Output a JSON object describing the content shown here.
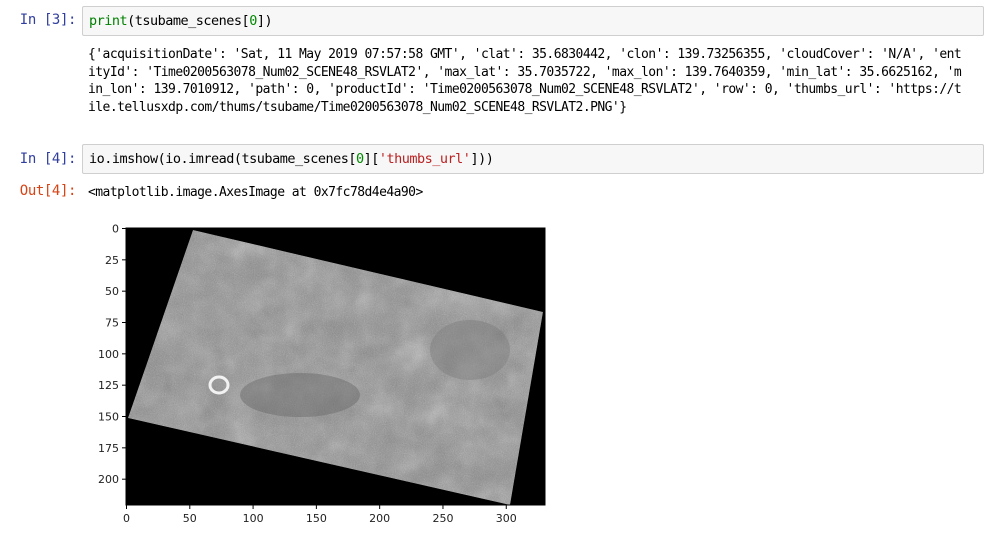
{
  "cells": [
    {
      "prompt": "In [3]:",
      "code": {
        "fn": "print",
        "arg_open": "(tsubame_scenes[",
        "index": "0",
        "arg_close": "])"
      },
      "output": "{'acquisitionDate': 'Sat, 11 May 2019 07:57:58 GMT', 'clat': 35.6830442, 'clon': 139.73256355, 'cloudCover': 'N/A', 'entityId': 'Time0200563078_Num02_SCENE48_RSVLAT2', 'max_lat': 35.7035722, 'max_lon': 139.7640359, 'min_lat': 35.6625162, 'min_lon': 139.7010912, 'path': 0, 'productId': 'Time0200563078_Num02_SCENE48_RSVLAT2', 'row': 0, 'thumbs_url': 'https://tile.tellusxdp.com/thums/tsubame/Time0200563078_Num02_SCENE48_RSVLAT2.PNG'}"
    },
    {
      "prompt": "In [4]:",
      "code": {
        "pre": "io.imshow(io.imread(tsubame_scenes[",
        "index": "0",
        "mid": "][",
        "key": "'thumbs_url'",
        "post": "]))"
      },
      "out_prompt": "Out[4]:",
      "output": "<matplotlib.image.AxesImage at 0x7fc78d4e4a90>"
    }
  ],
  "plot": {
    "x_ticks": [
      "0",
      "50",
      "100",
      "150",
      "200",
      "250",
      "300"
    ],
    "y_ticks": [
      "0",
      "25",
      "50",
      "75",
      "100",
      "125",
      "150",
      "175",
      "200"
    ],
    "xlim": [
      0,
      331
    ],
    "ylim": [
      0,
      221
    ],
    "image_description_colors": {
      "background": "#000000",
      "scene": "#8a8a8a"
    }
  }
}
